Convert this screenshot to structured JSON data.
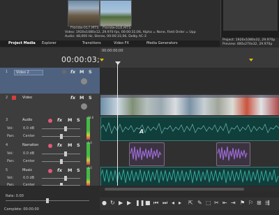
{
  "media": {
    "thumbs": [
      {
        "label": "Florida-017.MTS"
      },
      {
        "label": "Florida-018.MTS"
      }
    ],
    "info_line1": "Video: 1920x1080x12, 29.970 fps, 00:00:31;06, Alpha = None, Field Order = Upp",
    "info_line2": "Audio: 48,000 Hz, Stereo, 00:00:31;06, Dolby AC-3"
  },
  "tabs": [
    "Project Media",
    "Explorer",
    "Transitions",
    "Video FX",
    "Media Generators"
  ],
  "preview": {
    "project": "Project:   1920x1080x32, 29.970p",
    "preview": "Preview:  480x270x32, 29.970p"
  },
  "timeline": {
    "timecode": "00:00:03;16",
    "ruler_label": "00:00:00;00"
  },
  "tracks": [
    {
      "num": "1",
      "name": "Video 2",
      "sel": true
    },
    {
      "num": "2",
      "name": "Video",
      "sel": false
    },
    {
      "num": "3",
      "name": "Audio",
      "vol_label": "Vol:",
      "vol": "0.0 dB",
      "pan_label": "Pan:",
      "pan": "Center",
      "meter": "-18.6"
    },
    {
      "num": "4",
      "name": "Narration",
      "vol_label": "Vol:",
      "vol": "0.0 dB",
      "pan_label": "Pan:",
      "pan": "Center",
      "meter": "-5.4"
    },
    {
      "num": "5",
      "name": "Music",
      "vol_label": "Vol:",
      "vol": "0.0 dB",
      "pan_label": "Pan:",
      "pan": "Center",
      "meter": "-4.0"
    }
  ],
  "buttons": {
    "fx": "fx",
    "m": "M",
    "s": "S"
  },
  "status": {
    "rate": "Rate: 0.00",
    "complete": "Complete: 00:00:00"
  },
  "clips": {
    "text_marker": "A"
  },
  "colors": {
    "accent_selection": "#4e6280",
    "audio_clip": "#0f3e3b",
    "narration_wave": "#9b6ad4",
    "music_wave": "#2fa79a"
  }
}
